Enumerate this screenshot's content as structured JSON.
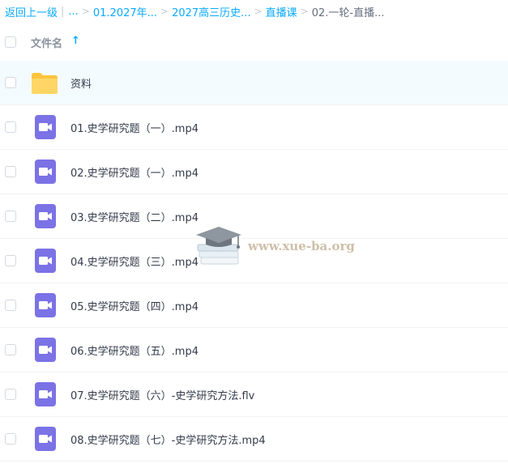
{
  "breadcrumb": {
    "back_label": "返回上一级",
    "ellipsis": "...",
    "items": [
      "01.2027年...",
      "2027高三历史...",
      "直播课"
    ],
    "current": "02.一轮-直播..."
  },
  "header": {
    "column_label": "文件名",
    "sort_indicator": "↑"
  },
  "files": [
    {
      "name": "资料",
      "icon": "folder-icon"
    },
    {
      "name": "01.史学研究题（一）.mp4",
      "icon": "video-icon"
    },
    {
      "name": "02.史学研究题（一）.mp4",
      "icon": "video-icon"
    },
    {
      "name": "03.史学研究题（二）.mp4",
      "icon": "video-icon"
    },
    {
      "name": "04.史学研究题（三）.mp4",
      "icon": "video-icon"
    },
    {
      "name": "05.史学研究题（四）.mp4",
      "icon": "video-icon"
    },
    {
      "name": "06.史学研究题（五）.mp4",
      "icon": "video-icon"
    },
    {
      "name": "07.史学研究题（六）-史学研究方法.flv",
      "icon": "video-icon"
    },
    {
      "name": "08.史学研究题（七）-史学研究方法.mp4",
      "icon": "video-icon"
    }
  ],
  "watermark": {
    "text": "www.xue-ba.org"
  },
  "colors": {
    "link": "#09aaff",
    "video_icon": "#7b72e6",
    "folder": "#ffc53d",
    "row_hover": "#f4fbff"
  }
}
